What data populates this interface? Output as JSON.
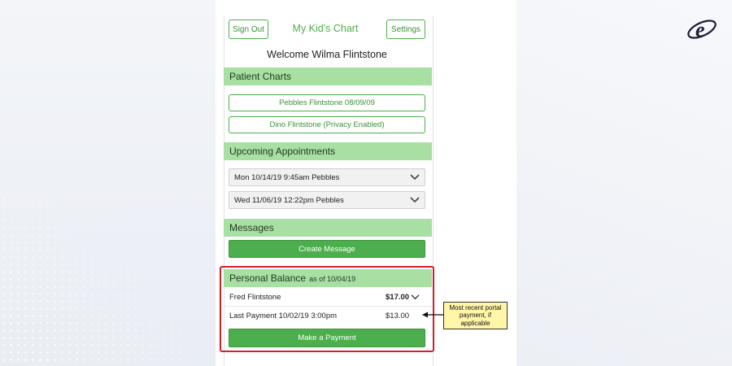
{
  "header": {
    "sign_out_label": "Sign Out",
    "app_title": "My Kid's Chart",
    "settings_label": "Settings",
    "welcome": "Welcome Wilma Flintstone"
  },
  "patient_charts": {
    "heading": "Patient Charts",
    "items": [
      "Pebbles Flintstone 08/09/09",
      "Dino Flintstone (Privacy Enabled)"
    ]
  },
  "appointments": {
    "heading": "Upcoming Appointments",
    "items": [
      "Mon 10/14/19 9:45am Pebbles",
      "Wed 11/06/19 12:22pm Pebbles"
    ]
  },
  "messages": {
    "heading": "Messages",
    "create_label": "Create Message"
  },
  "balance": {
    "heading": "Personal Balance",
    "as_of": "as of 10/04/19",
    "account_name": "Fred Flintstone",
    "account_amount": "$17.00",
    "last_payment_label": "Last Payment 10/02/19 3:00pm",
    "last_payment_amount": "$13.00",
    "pay_label": "Make a Payment"
  },
  "callout": {
    "text": "Most recent portal payment, if applicable"
  },
  "colors": {
    "accent_green": "#4cae4c",
    "section_green": "#a8dfa3",
    "highlight_red": "#d0202a",
    "callout_yellow": "#fff6a8"
  },
  "icons": {
    "logo": "e-logo-icon",
    "dropdown": "chevron-down-icon",
    "pointer": "arrow-left-icon"
  }
}
